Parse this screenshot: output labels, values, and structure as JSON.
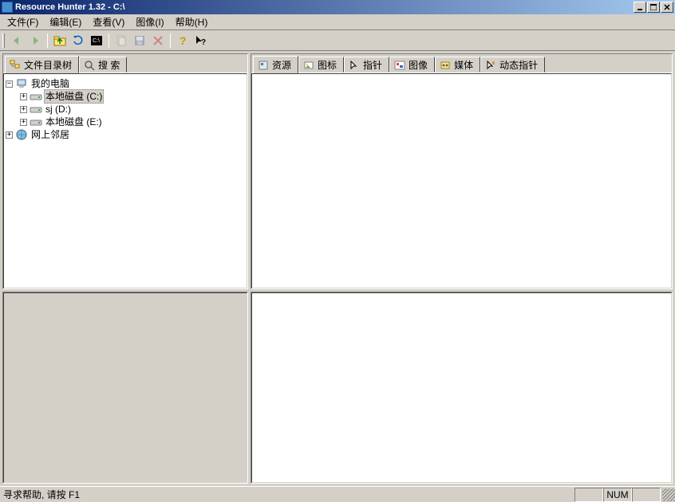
{
  "title": "Resource Hunter 1.32 - C:\\",
  "menu": {
    "file": "文件(F)",
    "edit": "编辑(E)",
    "view": "查看(V)",
    "image": "图像(I)",
    "help": "帮助(H)"
  },
  "toolbar_icons": {
    "back": "back-arrow",
    "forward": "forward-arrow",
    "up": "folder-up",
    "terminal": "terminal",
    "dos": "cmd",
    "copy": "copy",
    "save": "save",
    "delete": "delete",
    "help": "help-question",
    "whats_this": "whats-this"
  },
  "left_tabs": {
    "tree": "文件目录树",
    "search": "搜 索"
  },
  "right_tabs": {
    "resource": "资源",
    "icon": "图标",
    "cursor": "指针",
    "image": "图像",
    "media": "媒体",
    "ani_cursor": "动态指针"
  },
  "tree": {
    "root": "我的电脑",
    "drive_c": "本地磁盘 (C:)",
    "drive_d": "sj (D:)",
    "drive_e": "本地磁盘 (E:)",
    "network": "网上邻居"
  },
  "status": {
    "help": "寻求帮助, 请按 F1",
    "num": "NUM"
  }
}
